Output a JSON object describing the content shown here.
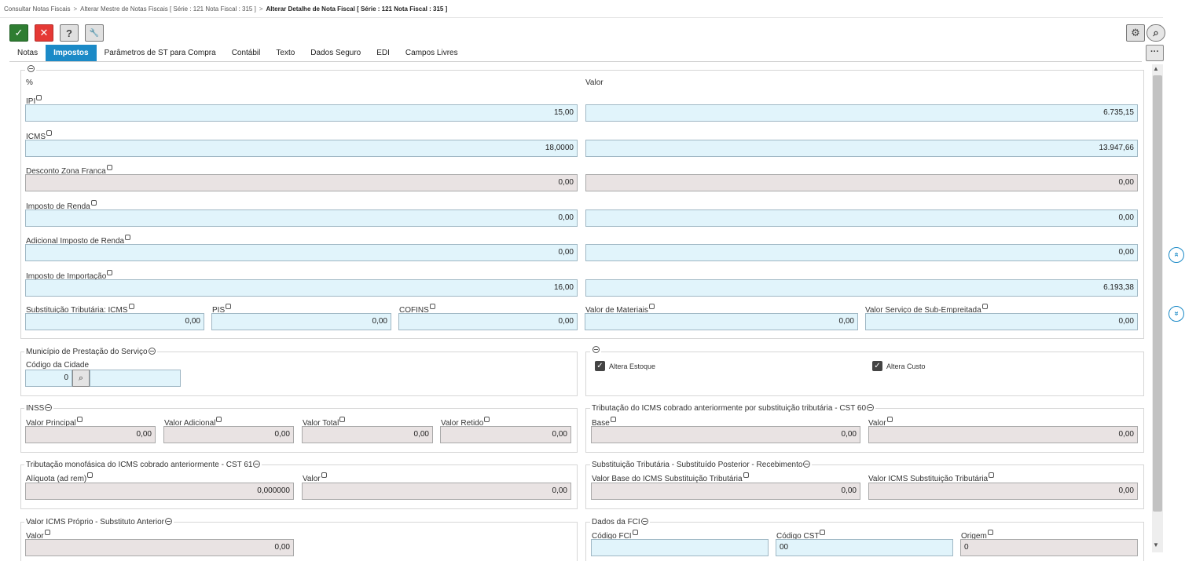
{
  "breadcrumb": {
    "items": [
      "Consultar Notas Fiscais",
      "Alterar Mestre de Notas Fiscais [ Série : 121 Nota Fiscal : 315 ]"
    ],
    "current": "Alterar Detalhe de Nota Fiscal [ Série : 121 Nota Fiscal : 315 ]"
  },
  "toolbar": {
    "ok": "✓",
    "cancel": "✕",
    "help": "?",
    "tool": "🔧",
    "gear": "⚙",
    "search": "⌕",
    "more": "···"
  },
  "tabs": [
    "Notas",
    "Impostos",
    "Parâmetros de ST para Compra",
    "Contábil",
    "Texto",
    "Dados Seguro",
    "EDI",
    "Campos Livres"
  ],
  "active_tab": "Impostos",
  "impostos": {
    "col_pct": "%",
    "col_valor": "Valor",
    "ipi": {
      "label": "IPI",
      "pct": "15,00",
      "valor": "6.735,15"
    },
    "icms": {
      "label": "ICMS",
      "pct": "18,0000",
      "valor": "13.947,66"
    },
    "desconto_zona_franca": {
      "label": "Desconto Zona Franca",
      "pct": "0,00",
      "valor": "0,00"
    },
    "imposto_renda": {
      "label": "Imposto de Renda",
      "pct": "0,00",
      "valor": "0,00"
    },
    "adicional_ir": {
      "label": "Adicional Imposto de Renda",
      "pct": "0,00",
      "valor": "0,00"
    },
    "imposto_importacao": {
      "label": "Imposto de Importação",
      "pct": "16,00",
      "valor": "6.193,38"
    },
    "st_icms": {
      "label": "Substituição Tributária: ICMS",
      "value": "0,00"
    },
    "pis": {
      "label": "PIS",
      "value": "0,00"
    },
    "cofins": {
      "label": "COFINS",
      "value": "0,00"
    },
    "valor_materiais": {
      "label": "Valor de Materiais",
      "value": "0,00"
    },
    "valor_servico": {
      "label": "Valor Serviço de Sub-Empreitada",
      "value": "0,00"
    }
  },
  "municipio": {
    "legend": "Município de Prestação do Serviço",
    "codigo_label": "Código da Cidade",
    "codigo_value": "0",
    "search_icon": "⌕",
    "desc_value": ""
  },
  "flags": {
    "altera_estoque": "Altera Estoque",
    "altera_custo": "Altera Custo",
    "check": "✓"
  },
  "inss": {
    "legend": "INSS",
    "principal": {
      "label": "Valor Principal",
      "value": "0,00"
    },
    "adicional": {
      "label": "Valor Adicional",
      "value": "0,00"
    },
    "total": {
      "label": "Valor Total",
      "value": "0,00"
    },
    "retido": {
      "label": "Valor Retido",
      "value": "0,00"
    }
  },
  "cst60": {
    "legend": "Tributação do ICMS cobrado anteriormente por substituição tributária - CST 60",
    "base": {
      "label": "Base",
      "value": "0,00"
    },
    "valor": {
      "label": "Valor",
      "value": "0,00"
    }
  },
  "cst61": {
    "legend": "Tributação monofásica do ICMS cobrado anteriormente - CST 61",
    "aliquota": {
      "label": "Alíquota (ad rem)",
      "value": "0,000000"
    },
    "valor": {
      "label": "Valor",
      "value": "0,00"
    }
  },
  "st_posterior": {
    "legend": "Substituição Tributária - Substituído Posterior - Recebimento",
    "base": {
      "label": "Valor Base do ICMS Substituição Tributária",
      "value": "0,00"
    },
    "valor": {
      "label": "Valor ICMS Substituição Tributária",
      "value": "0,00"
    }
  },
  "icms_proprio": {
    "legend": "Valor ICMS Próprio - Substituto Anterior",
    "valor": {
      "label": "Valor",
      "value": "0,00"
    }
  },
  "fci": {
    "legend": "Dados da FCI",
    "codigo_fci": {
      "label": "Código FCI",
      "value": ""
    },
    "codigo_cst": {
      "label": "Código CST",
      "value": "00"
    },
    "origem": {
      "label": "Origem",
      "value": "0"
    }
  },
  "nav": {
    "up": "»",
    "down": "»",
    "scroll_up": "▲",
    "scroll_down": "▼"
  }
}
